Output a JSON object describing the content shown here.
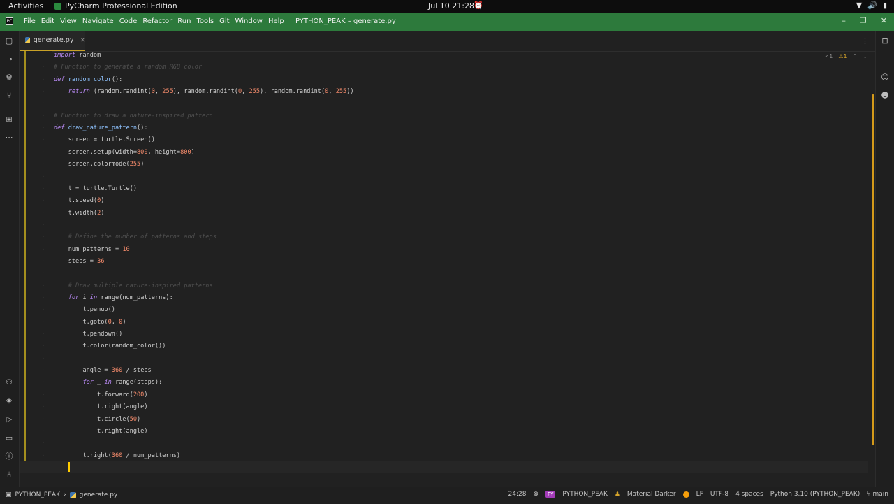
{
  "system_bar": {
    "activities": "Activities",
    "app_name": "PyCharm Professional Edition",
    "clock": "Jul 10  21:28"
  },
  "menubar": {
    "items": [
      "File",
      "Edit",
      "View",
      "Navigate",
      "Code",
      "Refactor",
      "Run",
      "Tools",
      "Git",
      "Window",
      "Help"
    ],
    "window_title": "PYTHON_PEAK – generate.py"
  },
  "editor_tab": {
    "filename": "generate.py"
  },
  "code": {
    "lines": [
      [
        {
          "t": "import",
          "c": "kw"
        },
        {
          "t": " random"
        }
      ],
      [
        {
          "t": "# Function to generate a random RGB color",
          "c": "cm"
        }
      ],
      [
        {
          "t": "def",
          "c": "kw"
        },
        {
          "t": " "
        },
        {
          "t": "random_color",
          "c": "fn"
        },
        {
          "t": "():"
        }
      ],
      [
        {
          "t": "    "
        },
        {
          "t": "return",
          "c": "kw"
        },
        {
          "t": " (random.randint("
        },
        {
          "t": "0",
          "c": "num"
        },
        {
          "t": ", "
        },
        {
          "t": "255",
          "c": "num"
        },
        {
          "t": "), random.randint("
        },
        {
          "t": "0",
          "c": "num"
        },
        {
          "t": ", "
        },
        {
          "t": "255",
          "c": "num"
        },
        {
          "t": "), random.randint("
        },
        {
          "t": "0",
          "c": "num"
        },
        {
          "t": ", "
        },
        {
          "t": "255",
          "c": "num"
        },
        {
          "t": "))"
        }
      ],
      [],
      [
        {
          "t": "# Function to draw a nature-inspired pattern",
          "c": "cm"
        }
      ],
      [
        {
          "t": "def",
          "c": "kw"
        },
        {
          "t": " "
        },
        {
          "t": "draw_nature_pattern",
          "c": "fn"
        },
        {
          "t": "():"
        }
      ],
      [
        {
          "t": "    screen = turtle.Screen()"
        }
      ],
      [
        {
          "t": "    screen.setup(width="
        },
        {
          "t": "800",
          "c": "num"
        },
        {
          "t": ", height="
        },
        {
          "t": "800",
          "c": "num"
        },
        {
          "t": ")"
        }
      ],
      [
        {
          "t": "    screen.colormode("
        },
        {
          "t": "255",
          "c": "num"
        },
        {
          "t": ")"
        }
      ],
      [],
      [
        {
          "t": "    t = turtle.Turtle()"
        }
      ],
      [
        {
          "t": "    t.speed("
        },
        {
          "t": "0",
          "c": "num"
        },
        {
          "t": ")"
        }
      ],
      [
        {
          "t": "    t.width("
        },
        {
          "t": "2",
          "c": "num"
        },
        {
          "t": ")"
        }
      ],
      [],
      [
        {
          "t": "    # Define the number of patterns and steps",
          "c": "cm"
        }
      ],
      [
        {
          "t": "    num_patterns = "
        },
        {
          "t": "10",
          "c": "num"
        }
      ],
      [
        {
          "t": "    steps = "
        },
        {
          "t": "36",
          "c": "num"
        }
      ],
      [],
      [
        {
          "t": "    # Draw multiple nature-inspired patterns",
          "c": "cm"
        }
      ],
      [
        {
          "t": "    "
        },
        {
          "t": "for",
          "c": "kw"
        },
        {
          "t": " i "
        },
        {
          "t": "in",
          "c": "kw"
        },
        {
          "t": " range(num_patterns):"
        }
      ],
      [
        {
          "t": "        t.penup()"
        }
      ],
      [
        {
          "t": "        t.goto("
        },
        {
          "t": "0",
          "c": "num"
        },
        {
          "t": ", "
        },
        {
          "t": "0",
          "c": "num"
        },
        {
          "t": ")"
        }
      ],
      [
        {
          "t": "        t.pendown()"
        }
      ],
      [
        {
          "t": "        t.color(random_color())"
        }
      ],
      [],
      [
        {
          "t": "        angle = "
        },
        {
          "t": "360",
          "c": "num"
        },
        {
          "t": " / steps"
        }
      ],
      [
        {
          "t": "        "
        },
        {
          "t": "for",
          "c": "kw"
        },
        {
          "t": " _ "
        },
        {
          "t": "in",
          "c": "kw"
        },
        {
          "t": " range(steps):"
        }
      ],
      [
        {
          "t": "            t.forward("
        },
        {
          "t": "200",
          "c": "num"
        },
        {
          "t": ")"
        }
      ],
      [
        {
          "t": "            t.right(angle)"
        }
      ],
      [
        {
          "t": "            t.circle("
        },
        {
          "t": "50",
          "c": "num"
        },
        {
          "t": ")"
        }
      ],
      [
        {
          "t": "            t.right(angle)"
        }
      ],
      [],
      [
        {
          "t": "        t.right("
        },
        {
          "t": "360",
          "c": "num"
        },
        {
          "t": " / num_patterns)"
        }
      ],
      []
    ]
  },
  "inspections": {
    "typo_count": "1",
    "warning_count": "1"
  },
  "status": {
    "project": "PYTHON_PEAK",
    "file": "generate.py",
    "position": "24:28",
    "py_badge": "PY",
    "project_name": "PYTHON_PEAK",
    "theme": "Material Darker",
    "line_sep": "LF",
    "encoding": "UTF-8",
    "indent": "4 spaces",
    "interpreter": "Python 3.10 (PYTHON_PEAK)",
    "branch": "main"
  },
  "colors": {
    "menubar": "#2d7a3c",
    "accent": "#c9a227",
    "keyword": "#b98af5",
    "number": "#f78c6c"
  }
}
